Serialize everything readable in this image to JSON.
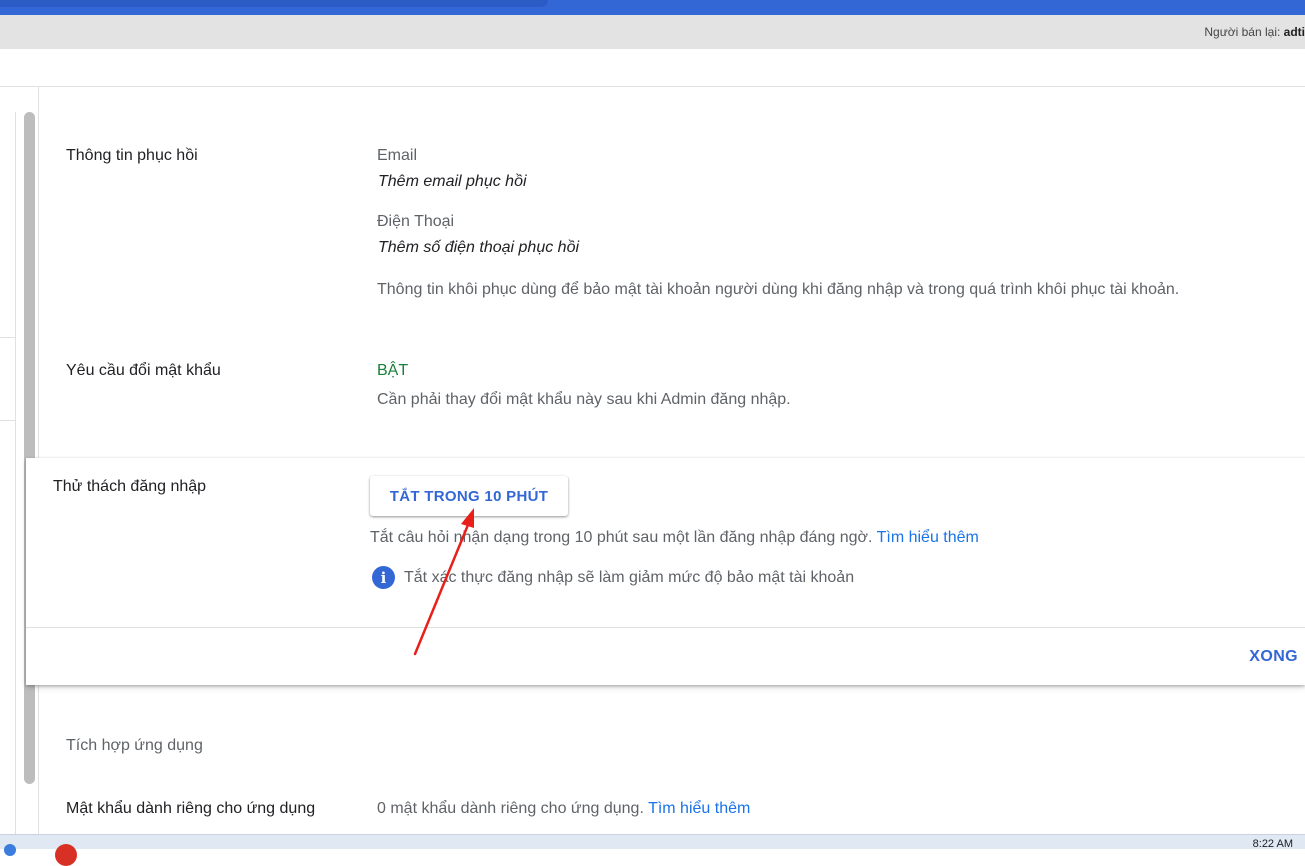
{
  "header": {
    "reseller_label": "Người bán lại:",
    "reseller_value": "adti"
  },
  "sections": {
    "recovery": {
      "label": "Thông tin phục hồi",
      "email_title": "Email",
      "email_value": "Thêm email phục hồi",
      "phone_title": "Điện Thoại",
      "phone_value": "Thêm số điện thoại phục hồi",
      "description": "Thông tin khôi phục dùng để bảo mật tài khoản người dùng khi đăng nhập và trong quá trình khôi phục tài khoản."
    },
    "password_change": {
      "label": "Yêu cầu đổi mật khẩu",
      "status": "BẬT",
      "status_color": "#188038",
      "description": "Cần phải thay đổi mật khẩu này sau khi Admin đăng nhập."
    },
    "login_challenge": {
      "label": "Thử thách đăng nhập",
      "button_label": "TẮT TRONG 10 PHÚT",
      "description": "Tắt câu hỏi nhận dạng trong 10 phút sau một lần đăng nhập đáng ngờ.",
      "learn_more": "Tìm hiểu thêm",
      "warning_icon": "info-icon",
      "warning": "Tắt xác thực đăng nhập sẽ làm giảm mức độ bảo mật tài khoản",
      "done_label": "XONG"
    },
    "app_integration": {
      "label": "Tích hợp ứng dụng"
    },
    "app_passwords": {
      "label": "Mật khẩu dành riêng cho ứng dụng",
      "description": "0 mật khẩu dành riêng cho ứng dụng.",
      "learn_more": "Tìm hiểu thêm"
    }
  },
  "taskbar": {
    "clock": "8:22 AM"
  },
  "colors": {
    "accent": "#3367d6",
    "link": "#1a73e8",
    "annotation_arrow": "#e8201a"
  }
}
